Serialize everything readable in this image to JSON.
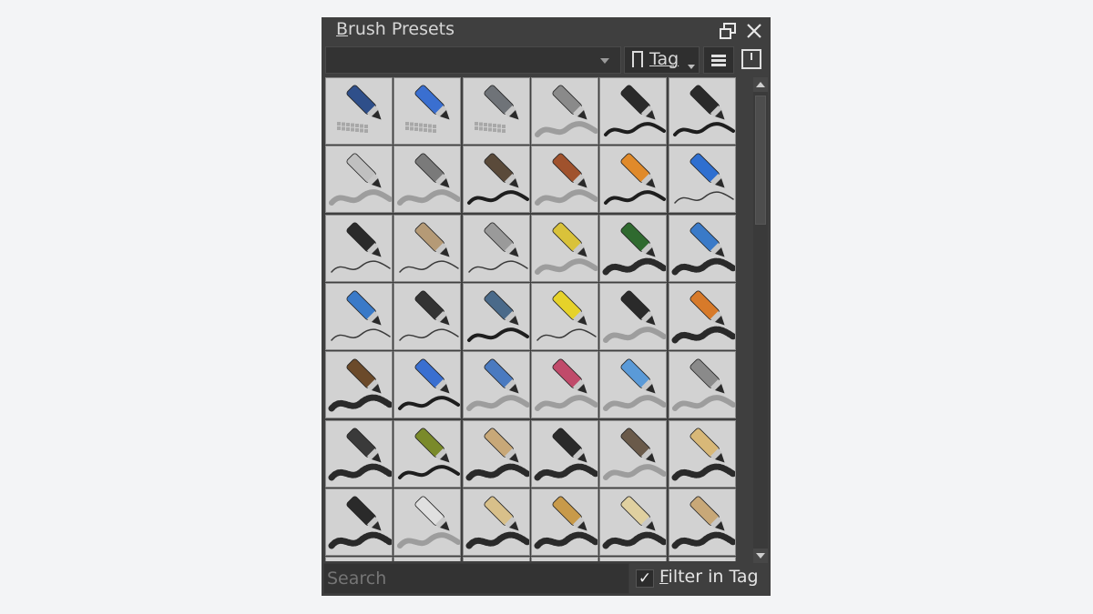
{
  "docker": {
    "title_accel": "B",
    "title_rest": "rush Presets",
    "float_icon": "float-window-icon",
    "close_icon": "close-icon"
  },
  "toolbar": {
    "tag_combo_value": "",
    "tag_button_label": "Tag",
    "tag_icon": "bookmark-icon",
    "menu_icon": "hamburger-menu-icon",
    "import_icon": "import-resources-icon"
  },
  "presets": [
    {
      "icon": "eraser-icon",
      "color": "#2f4f8a",
      "stroke": "checker"
    },
    {
      "icon": "eraser-pen-icon",
      "color": "#3a6fd0",
      "stroke": "checker"
    },
    {
      "icon": "eraser-soft-icon",
      "color": "#6f7378",
      "stroke": "checker"
    },
    {
      "icon": "airbrush-icon",
      "color": "#8a8a8a",
      "stroke": "soft"
    },
    {
      "icon": "ink-pen-icon",
      "color": "#2a2a2a",
      "stroke": "solid"
    },
    {
      "icon": "marker-icon",
      "color": "#2a2a2a",
      "stroke": "solid"
    },
    {
      "icon": "pen-silver-icon",
      "color": "#c0c0c0",
      "stroke": "soft"
    },
    {
      "icon": "pen-grey-icon",
      "color": "#7a7a7a",
      "stroke": "soft"
    },
    {
      "icon": "brush-pen-icon",
      "color": "#5a4a3a",
      "stroke": "solid"
    },
    {
      "icon": "fine-brush-icon",
      "color": "#a0522d",
      "stroke": "soft"
    },
    {
      "icon": "round-brush-orange-icon",
      "color": "#e08a2a",
      "stroke": "solid"
    },
    {
      "icon": "blue-pencil-icon",
      "color": "#2f6fd0",
      "stroke": "line"
    },
    {
      "icon": "pencil-dark-icon",
      "color": "#2a2a2a",
      "stroke": "line"
    },
    {
      "icon": "pencil-wood-icon",
      "color": "#b59a76",
      "stroke": "line"
    },
    {
      "icon": "pencil-metal-icon",
      "color": "#9a9a9a",
      "stroke": "line"
    },
    {
      "icon": "pencil-yellow-icon",
      "color": "#d9c23a",
      "stroke": "soft"
    },
    {
      "icon": "pencil-green-icon",
      "color": "#2f6a2f",
      "stroke": "texture"
    },
    {
      "icon": "pencil-blue-icon",
      "color": "#3a7ac8",
      "stroke": "texture"
    },
    {
      "icon": "pencil-blue-2-icon",
      "color": "#3a7ac8",
      "stroke": "line"
    },
    {
      "icon": "pencil-black-icon",
      "color": "#333333",
      "stroke": "line"
    },
    {
      "icon": "tech-pen-icon",
      "color": "#4a6a8a",
      "stroke": "solid"
    },
    {
      "icon": "fountain-pen-yellow-icon",
      "color": "#e6d22a",
      "stroke": "line"
    },
    {
      "icon": "fountain-pen-black-icon",
      "color": "#2a2a2a",
      "stroke": "soft"
    },
    {
      "icon": "round-brush-icon",
      "color": "#d77a2a",
      "stroke": "texture"
    },
    {
      "icon": "ink-brush-icon",
      "color": "#6b4a2a",
      "stroke": "texture"
    },
    {
      "icon": "marker-blue-icon",
      "color": "#3a6fd0",
      "stroke": "solid"
    },
    {
      "icon": "marker-blue-2-icon",
      "color": "#4a7ac0",
      "stroke": "soft"
    },
    {
      "icon": "marker-pink-icon",
      "color": "#c04a6a",
      "stroke": "soft"
    },
    {
      "icon": "marker-cyan-icon",
      "color": "#5a9ad8",
      "stroke": "soft"
    },
    {
      "icon": "marker-grey-icon",
      "color": "#8a8a8a",
      "stroke": "soft"
    },
    {
      "icon": "marker-black-icon",
      "color": "#3a3a3a",
      "stroke": "texture"
    },
    {
      "icon": "brush-green-icon",
      "color": "#7a8a2a",
      "stroke": "solid"
    },
    {
      "icon": "fan-brush-icon",
      "color": "#c8a878",
      "stroke": "texture"
    },
    {
      "icon": "flat-brush-icon",
      "color": "#2a2a2a",
      "stroke": "texture"
    },
    {
      "icon": "bristle-brush-icon",
      "color": "#6a5a4a",
      "stroke": "soft"
    },
    {
      "icon": "wide-brush-icon",
      "color": "#d8b878",
      "stroke": "texture"
    },
    {
      "icon": "smudge-icon",
      "color": "#2a2a2a",
      "stroke": "texture"
    },
    {
      "icon": "roller-icon",
      "color": "#e0e0e0",
      "stroke": "soft"
    },
    {
      "icon": "filbert-brush-icon",
      "color": "#d8c08a",
      "stroke": "texture"
    },
    {
      "icon": "splay-brush-icon",
      "color": "#c89a4a",
      "stroke": "texture"
    },
    {
      "icon": "dry-brush-icon",
      "color": "#e0d0a0",
      "stroke": "texture"
    },
    {
      "icon": "oil-brush-icon",
      "color": "#c8a878",
      "stroke": "texture"
    },
    {
      "icon": "partial-1-icon",
      "color": "#6a8a2a",
      "stroke": "none"
    },
    {
      "icon": "partial-2-icon",
      "color": "#b59a76",
      "stroke": "none"
    },
    {
      "icon": "partial-3-icon",
      "color": "#8a8a8a",
      "stroke": "none"
    },
    {
      "icon": "partial-4-icon",
      "color": "#8a8a8a",
      "stroke": "none"
    },
    {
      "icon": "partial-5-icon",
      "color": "#a0522d",
      "stroke": "none"
    },
    {
      "icon": "partial-6-icon",
      "color": "#8a8a8a",
      "stroke": "none"
    }
  ],
  "search": {
    "placeholder": "Search",
    "value": ""
  },
  "filter": {
    "checked": true,
    "check_glyph": "✓",
    "label_accel": "F",
    "label_rest": "ilter in Tag"
  },
  "colors": {
    "panel_bg": "#3f3f3f",
    "tile_bg": "#d2d2d2",
    "page_bg": "#f3f4f6",
    "text": "#d6d6d6"
  }
}
